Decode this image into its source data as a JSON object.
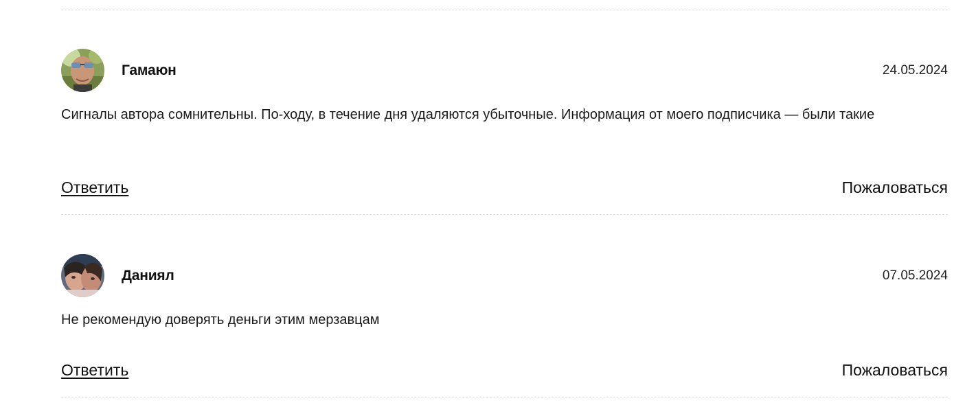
{
  "comments": [
    {
      "author": "Гамаюн",
      "date": "24.05.2024",
      "text": "Сигналы автора сомнительны. По-ходу, в течение дня удаляются убыточные. Информация от моего подписчика — были такие",
      "reply_label": "Ответить",
      "report_label": "Пожаловаться",
      "avatar_icon": "user-photo-avatar"
    },
    {
      "author": "Даниял",
      "date": "07.05.2024",
      "text": "Не рекомендую доверять деньги этим мерзавцам",
      "reply_label": "Ответить",
      "report_label": "Пожаловаться",
      "avatar_icon": "user-photo-avatar"
    }
  ],
  "colors": {
    "text": "#111111",
    "divider": "#dcdcdc",
    "background": "#ffffff"
  }
}
